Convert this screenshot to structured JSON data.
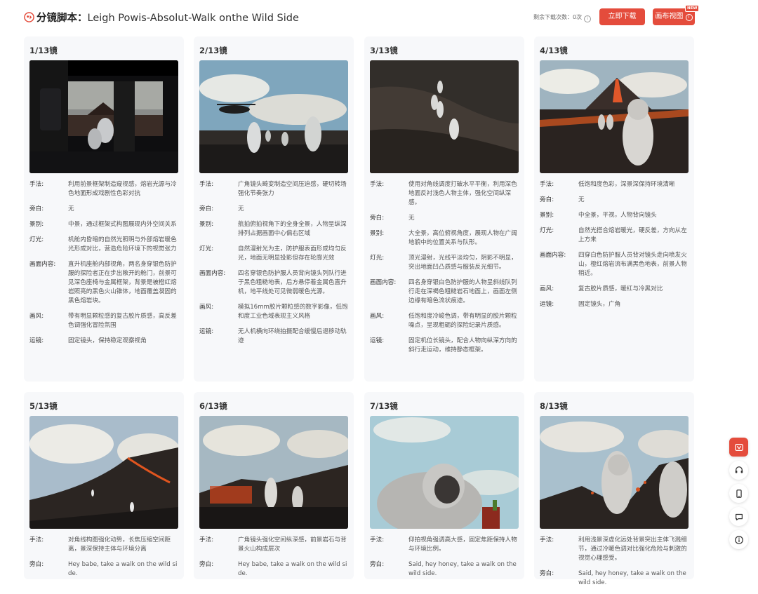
{
  "header": {
    "title_prefix": "分镜脚本：",
    "title": "Leigh Powis-Absolut-Walk onthe Wild Side",
    "download_count": "剩余下载次数：0次",
    "download_button": "立即下载",
    "publish_button": "画布视图",
    "new_badge": "NEW"
  },
  "labels": {
    "technique": "手法:",
    "narration": "旁白:",
    "shot": "景别:",
    "light": "灯光:",
    "content": "画面内容:",
    "style": "画风:",
    "camera": "运镜:"
  },
  "shots": [
    {
      "title": "1/13镜",
      "technique": "利用前景框架制造窥视感，熔岩光源与冷色地面形成戏剧性色彩对抗",
      "narration": "无",
      "shot": "中景，通过框架式构图展现内外空间关系",
      "light": "机舱内昏暗的自然光照明与外部熔岩暖色光形成对比，营造危险环境下的视觉张力",
      "content": "直升机座舱内部视角，两名身穿银色防护服的探险者正在步出敞开的舱门，前景可见深色座椅与金属框架，背景是被橙红熔岩照亮的黑色火山锥体，地面覆盖凝固的黑色熔岩块。",
      "style": "带有明显颗粒感的复古胶片质感，高反差色调强化冒险氛围",
      "camera": "固定镜头，保持稳定观察视角"
    },
    {
      "title": "2/13镜",
      "technique": "广角镜头畸变制造空间压迫感，硬切转场强化节奏张力",
      "narration": "无",
      "shot": "航拍俯拍视角下的全身全景，人物呈纵深排列占据画面中心偏右区域",
      "light": "自然漫射光为主，防护服表面形成均匀反光，地面无明显投影但存在轮廓光效",
      "content": "四名穿银色防护服人员背向镜头列队行进于黑色粗糙地表，后方悬停着金属色直升机，地平线处可见微弱暖色光源。",
      "style": "模拟16mm胶片颗粒感的数字影像，低饱和度工业色域表现主义风格",
      "camera": "无人机横向环绕拍摄配合缓慢后退移动轨迹"
    },
    {
      "title": "3/13镜",
      "technique": "使用对角线调度打破水平平衡，利用深色地面反衬浅色人物主体，强化空间纵深感。",
      "narration": "无",
      "shot": "大全景，高位俯视角度，展现人物在广阔地貌中的位置关系与队形。",
      "light": "顶光漫射，光线平淡均匀，阴影不明显，突出地面凹凸质感与服装反光细节。",
      "content": "四名身穿银白色防护服的人物呈斜线队列行走在深褐色粗糙岩石地面上，画面左侧边缘有暗色流状痕迹。",
      "style": "低饱和度冷峻色调，带有明显的胶片颗粒噪点，呈现粗砺的探险纪录片质感。",
      "camera": "固定机位长镜头，配合人物向纵深方向的斜行走运动，维持静态框架。"
    },
    {
      "title": "4/13镜",
      "technique": "低饱和度色彩，深景深保持环境清晰",
      "narration": "无",
      "shot": "中全景，平视，人物背向镜头",
      "light": "自然光搭合熔岩暖光，硬反差，方向从左上方来",
      "content": "四穿白色防护服人员背对镜头走向喷发火山，橙红熔岩流布满黑色地表，前景人物稍近。",
      "style": "复古胶片质感，暖红与冷黑对比",
      "camera": "固定镜头，广角"
    },
    {
      "title": "5/13镜",
      "technique": "对角线构图强化动势，长焦压缩空间距离，景深保持主体与环境分离",
      "narration": "Hey babe, take a walk on the wild side."
    },
    {
      "title": "6/13镜",
      "technique": "广角镜头强化空间纵深感，前景岩石与背景火山构成层次",
      "narration": "Hey babe, take a walk on the wild side."
    },
    {
      "title": "7/13镜",
      "technique": "仰拍视角强调高大感，固定焦距保持人物与环境比例。",
      "narration": "Said, hey honey, take a walk on the wild side."
    },
    {
      "title": "8/13镜",
      "technique": "利用浅景深虚化远处背景突出主体飞溅细节，通过冷暖色调对比强化危险与刺激的视觉心理感受。",
      "narration": "Said, hey honey, take a walk on the wild side."
    }
  ],
  "sidebar": [
    "translate-icon",
    "headset-icon",
    "phone-icon",
    "chat-icon",
    "info-icon"
  ]
}
